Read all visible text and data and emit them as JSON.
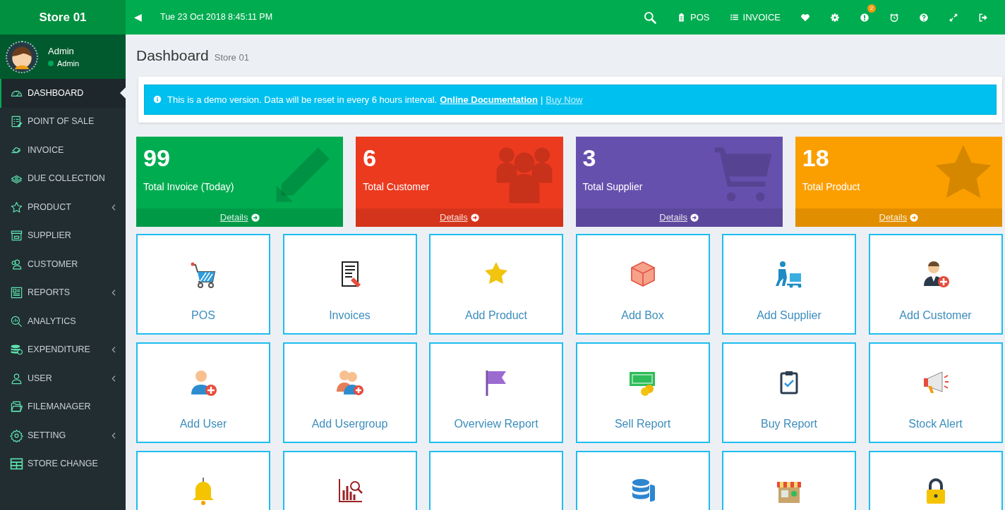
{
  "sidebar": {
    "brand": "Store 01",
    "user": {
      "name": "Admin",
      "role": "Admin",
      "online": true
    },
    "items": [
      {
        "label": "DASHBOARD",
        "kind": "gauge",
        "active": true,
        "submenu": false
      },
      {
        "label": "POINT OF SALE",
        "kind": "checklist",
        "active": false,
        "submenu": false
      },
      {
        "label": "INVOICE",
        "kind": "cash",
        "active": false,
        "submenu": false
      },
      {
        "label": "DUE COLLECTION",
        "kind": "money",
        "active": false,
        "submenu": false
      },
      {
        "label": "PRODUCT",
        "kind": "star",
        "active": false,
        "submenu": true
      },
      {
        "label": "SUPPLIER",
        "kind": "box",
        "active": false,
        "submenu": false
      },
      {
        "label": "CUSTOMER",
        "kind": "people",
        "active": false,
        "submenu": false
      },
      {
        "label": "REPORTS",
        "kind": "news",
        "active": false,
        "submenu": true
      },
      {
        "label": "ANALYTICS",
        "kind": "analytics",
        "active": false,
        "submenu": false
      },
      {
        "label": "EXPENDITURE",
        "kind": "coins",
        "active": false,
        "submenu": true
      },
      {
        "label": "USER",
        "kind": "user",
        "active": false,
        "submenu": true
      },
      {
        "label": "FILEMANAGER",
        "kind": "folder",
        "active": false,
        "submenu": false
      },
      {
        "label": "SETTING",
        "kind": "gear",
        "active": false,
        "submenu": true
      },
      {
        "label": "STORE CHANGE",
        "kind": "table",
        "active": false,
        "submenu": false
      }
    ]
  },
  "topbar": {
    "toggle": "◀",
    "datetime": "Tue 23 Oct 2018 8:45:11 PM",
    "actions": [
      {
        "kind": "search"
      },
      {
        "kind": "clipboard",
        "label": "POS"
      },
      {
        "kind": "list",
        "label": "INVOICE"
      },
      {
        "kind": "heart"
      },
      {
        "kind": "gear"
      },
      {
        "kind": "alert",
        "badge": "2"
      },
      {
        "kind": "alarm"
      },
      {
        "kind": "help"
      },
      {
        "kind": "expand"
      },
      {
        "kind": "logout"
      }
    ]
  },
  "page": {
    "title": "Dashboard",
    "subtitle": "Store 01"
  },
  "notice": {
    "text": "This is a demo version. Data will be reset in every 6 hours interval.",
    "links": [
      "Online Documentation",
      "Buy Now"
    ],
    "separator": "|"
  },
  "stats": [
    {
      "value": "99",
      "label": "Total Invoice (Today)",
      "details": "Details",
      "color": "#00ac50",
      "kind": "pencil"
    },
    {
      "value": "6",
      "label": "Total Customer",
      "details": "Details",
      "color": "#ec3a1f",
      "kind": "group"
    },
    {
      "value": "3",
      "label": "Total Supplier",
      "details": "Details",
      "color": "#6650ad",
      "kind": "cart"
    },
    {
      "value": "18",
      "label": "Total Product",
      "details": "Details",
      "color": "#fb9f00",
      "kind": "star"
    }
  ],
  "tiles": [
    {
      "label": "POS",
      "kind": "cart"
    },
    {
      "label": "Invoices",
      "kind": "receipt"
    },
    {
      "label": "Add Product",
      "kind": "star"
    },
    {
      "label": "Add Box",
      "kind": "box"
    },
    {
      "label": "Add Supplier",
      "kind": "trolley"
    },
    {
      "label": "Add Customer",
      "kind": "businessman"
    },
    {
      "label": "Add User",
      "kind": "user-add"
    },
    {
      "label": "Add Usergroup",
      "kind": "group-add"
    },
    {
      "label": "Overview Report",
      "kind": "flag"
    },
    {
      "label": "Sell Report",
      "kind": "banknote"
    },
    {
      "label": "Buy Report",
      "kind": "clipboard"
    },
    {
      "label": "Stock Alert",
      "kind": "megaphone"
    },
    {
      "kind": "bell"
    },
    {
      "kind": "chart"
    },
    {
      "kind": "blank"
    },
    {
      "kind": "database"
    },
    {
      "kind": "shop"
    },
    {
      "kind": "lock"
    }
  ]
}
